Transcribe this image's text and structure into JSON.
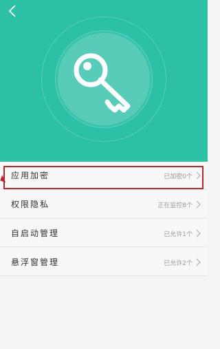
{
  "header": {
    "bg_color": "#2cc0a6",
    "back_icon": "chevron-left-icon",
    "center_icon": "key-icon"
  },
  "items": [
    {
      "label": "应用加密",
      "status": "已加密0个"
    },
    {
      "label": "权限隐私",
      "status": "正在监控8个"
    },
    {
      "label": "自启动管理",
      "status": "已允许1个"
    },
    {
      "label": "悬浮窗管理",
      "status": "已允许2个"
    }
  ],
  "annotation": {
    "color": "#b5262a"
  }
}
